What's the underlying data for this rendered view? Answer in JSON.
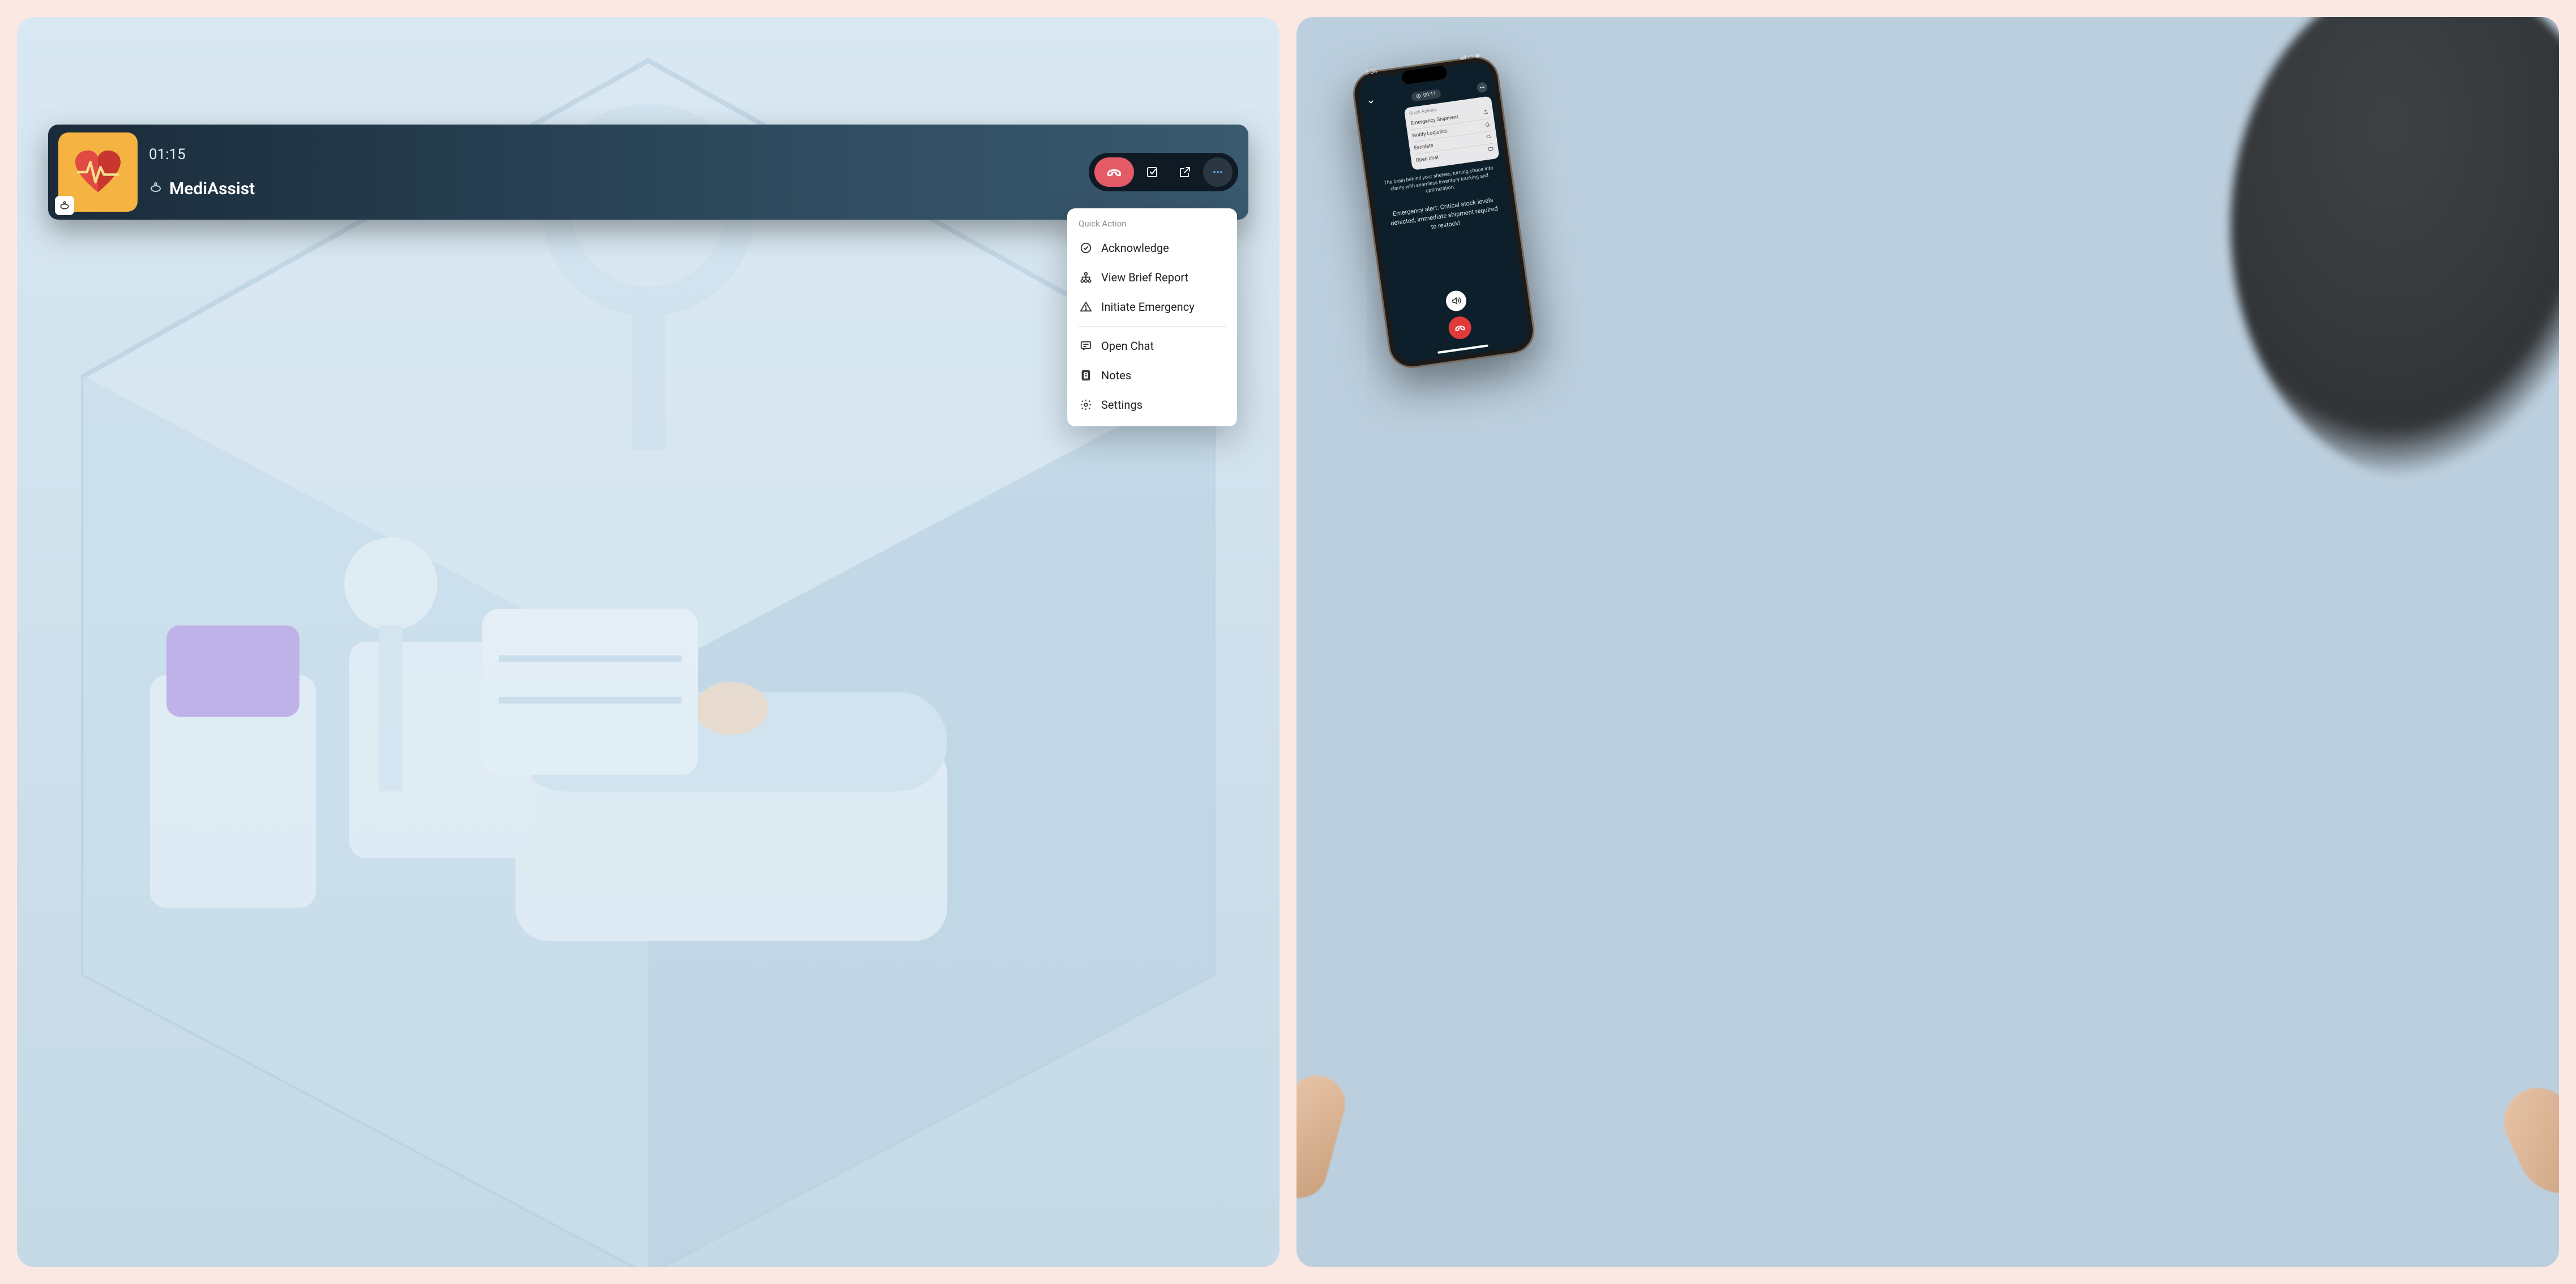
{
  "left": {
    "timer": "01:15",
    "caller_name": "MediAssist",
    "quick_action_title": "Quick Action",
    "items": {
      "acknowledge": "Acknowledge",
      "view_report": "View Brief Report",
      "emergency": "Initiate Emergency",
      "open_chat": "Open Chat",
      "notes": "Notes",
      "settings": "Settings"
    }
  },
  "right": {
    "status_time": "3:54",
    "call_timer": "00:11",
    "qa_title": "Quick Actions",
    "qa_items": {
      "shipment": "Emergency Shipment",
      "logistics": "Notify Logistics",
      "escalate": "Escalate",
      "open_chat": "Open chat"
    },
    "description": "The brain behind your shelves, turning chaos into clarity with seamless inventory tracking and optimization.",
    "alert": "Emergency alert: Critical stock levels detected, immediate shipment required to restock!"
  }
}
